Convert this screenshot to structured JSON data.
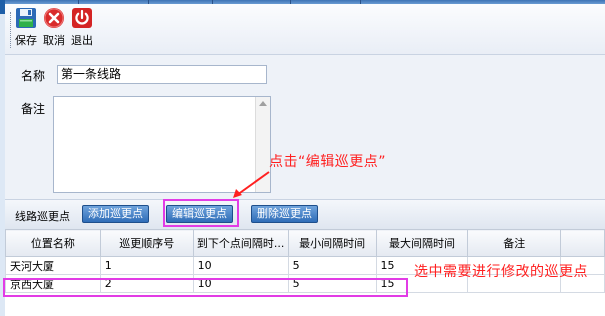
{
  "toolbar": {
    "save_label": "保存",
    "cancel_label": "取消",
    "exit_label": "退出"
  },
  "form": {
    "name_label": "名称",
    "name_value": "第一条线路",
    "note_label": "备注",
    "note_value": ""
  },
  "annotations": {
    "edit_hint": "点击“编辑巡更点”",
    "select_hint": "选中需要进行修改的巡更点"
  },
  "patrol_section": {
    "title": "线路巡更点",
    "add_label": "添加巡更点",
    "edit_label": "编辑巡更点",
    "delete_label": "删除巡更点"
  },
  "table": {
    "columns": [
      "位置名称",
      "巡更顺序号",
      "到下个点间隔时...",
      "最小间隔时间",
      "最大间隔时间",
      "备注"
    ],
    "rows": [
      [
        "天河大厦",
        "1",
        "10",
        "5",
        "15",
        ""
      ],
      [
        "京西大厦",
        "2",
        "10",
        "5",
        "15",
        ""
      ]
    ]
  },
  "colors": {
    "annotation": "#ff2020",
    "highlight": "#e23ce6",
    "button": "#2f6db8"
  }
}
